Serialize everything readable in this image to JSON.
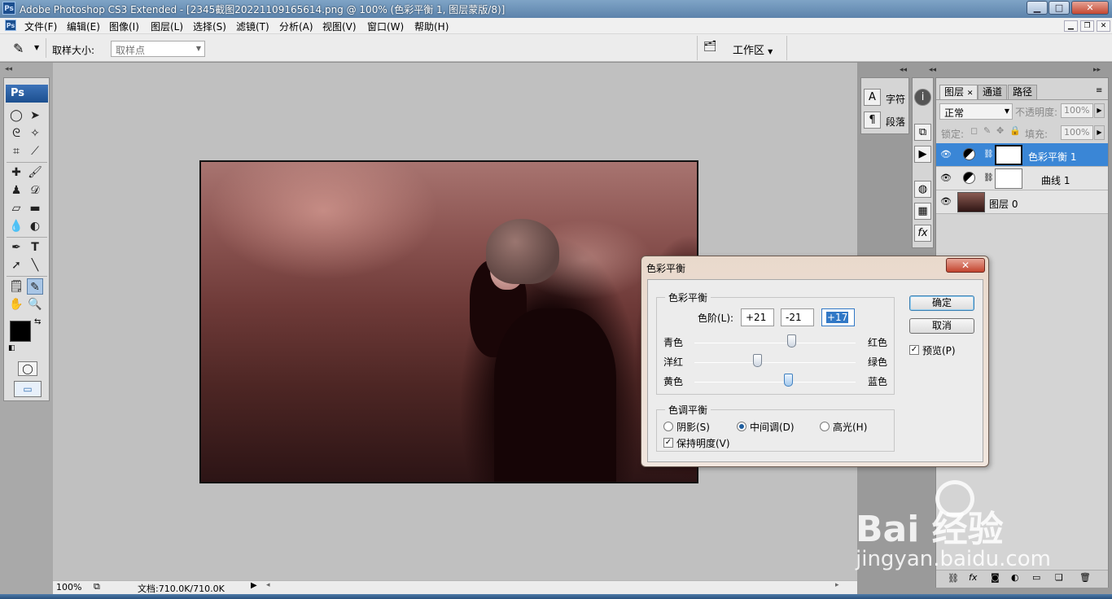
{
  "window": {
    "title": "Adobe Photoshop CS3 Extended - [2345截图20221109165614.png @ 100% (色彩平衡 1, 图层蒙版/8)]",
    "app_badge": "Ps",
    "min": "▁",
    "max": "□",
    "close": "✕"
  },
  "menu": [
    "文件(F)",
    "编辑(E)",
    "图像(I)",
    "图层(L)",
    "选择(S)",
    "滤镜(T)",
    "分析(A)",
    "视图(V)",
    "窗口(W)",
    "帮助(H)"
  ],
  "options": {
    "sample_size_label": "取样大小:",
    "sample_size_value": "取样点",
    "workspace": "工作区"
  },
  "toolbox": {
    "logo": "Ps"
  },
  "status": {
    "zoom": "100%",
    "doc": "文档:710.0K/710.0K"
  },
  "mini_panels": {
    "char": "字符",
    "para": "段落"
  },
  "layers_panel": {
    "tabs": [
      "图层",
      "通道",
      "路径"
    ],
    "blend_mode": "正常",
    "opacity_label": "不透明度:",
    "opacity": "100%",
    "lock_label": "锁定:",
    "fill_label": "填充:",
    "fill": "100%",
    "layers": [
      {
        "name": "色彩平衡 1",
        "selected": true
      },
      {
        "name": "曲线 1",
        "selected": false
      },
      {
        "name": "图层 0",
        "selected": false
      }
    ]
  },
  "dialog": {
    "title": "色彩平衡",
    "group1": "色彩平衡",
    "levels_label": "色阶(L):",
    "values": [
      "+21",
      "-21",
      "+17"
    ],
    "sliders": [
      {
        "left": "青色",
        "right": "红色",
        "value": 21
      },
      {
        "left": "洋红",
        "right": "绿色",
        "value": -21
      },
      {
        "left": "黄色",
        "right": "蓝色",
        "value": 17
      }
    ],
    "group2": "色调平衡",
    "radios": [
      "阴影(S)",
      "中间调(D)",
      "高光(H)"
    ],
    "radio_selected": 1,
    "preserve": "保持明度(V)",
    "ok": "确定",
    "cancel": "取消",
    "preview": "预览(P)"
  },
  "watermark": {
    "line1": "Bai 经验",
    "line2": "jingyan.baidu.com"
  }
}
